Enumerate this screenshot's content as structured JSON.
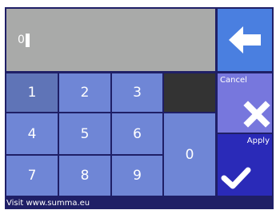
{
  "display": {
    "value": "0"
  },
  "keypad": {
    "keys": [
      "1",
      "2",
      "3",
      "4",
      "5",
      "6",
      "7",
      "8",
      "9",
      "0"
    ]
  },
  "actions": {
    "backspace_icon": "left-arrow-icon",
    "cancel_label": "Cancel",
    "cancel_icon": "x-icon",
    "apply_label": "Apply",
    "apply_icon": "checkmark-icon"
  },
  "footer": {
    "text": "Visit www.summa.eu"
  },
  "colors": {
    "frame": "#1f1f66",
    "display": "#a9aaa9",
    "key": "#6f86d6",
    "key_pressed": "#5f74b7",
    "backspace": "#4a7fe0",
    "cancel": "#7777dd",
    "apply": "#2a2ab8",
    "blank": "#333333"
  }
}
